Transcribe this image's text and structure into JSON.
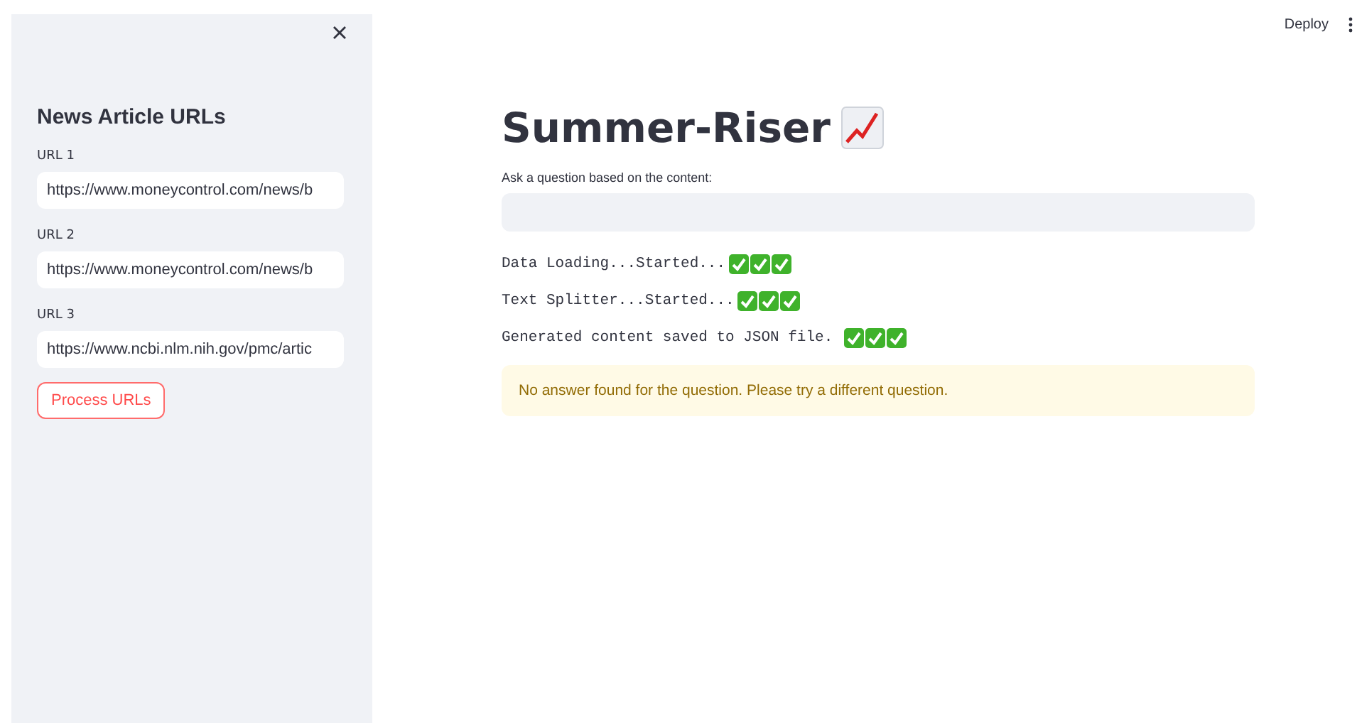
{
  "sidebar": {
    "heading": "News Article URLs",
    "fields": [
      {
        "label": "URL 1",
        "value": "https://www.moneycontrol.com/news/b"
      },
      {
        "label": "URL 2",
        "value": "https://www.moneycontrol.com/news/b"
      },
      {
        "label": "URL 3",
        "value": "https://www.ncbi.nlm.nih.gov/pmc/artic"
      }
    ],
    "button": "Process URLs"
  },
  "header": {
    "deploy": "Deploy"
  },
  "main": {
    "title": "Summer-Riser",
    "question": {
      "label": "Ask a question based on the content:"
    },
    "logs": [
      "Data Loading...Started...",
      "Text Splitter...Started...",
      "Generated content saved to JSON file. "
    ],
    "warning": "No answer found for the question. Please try a different question."
  }
}
